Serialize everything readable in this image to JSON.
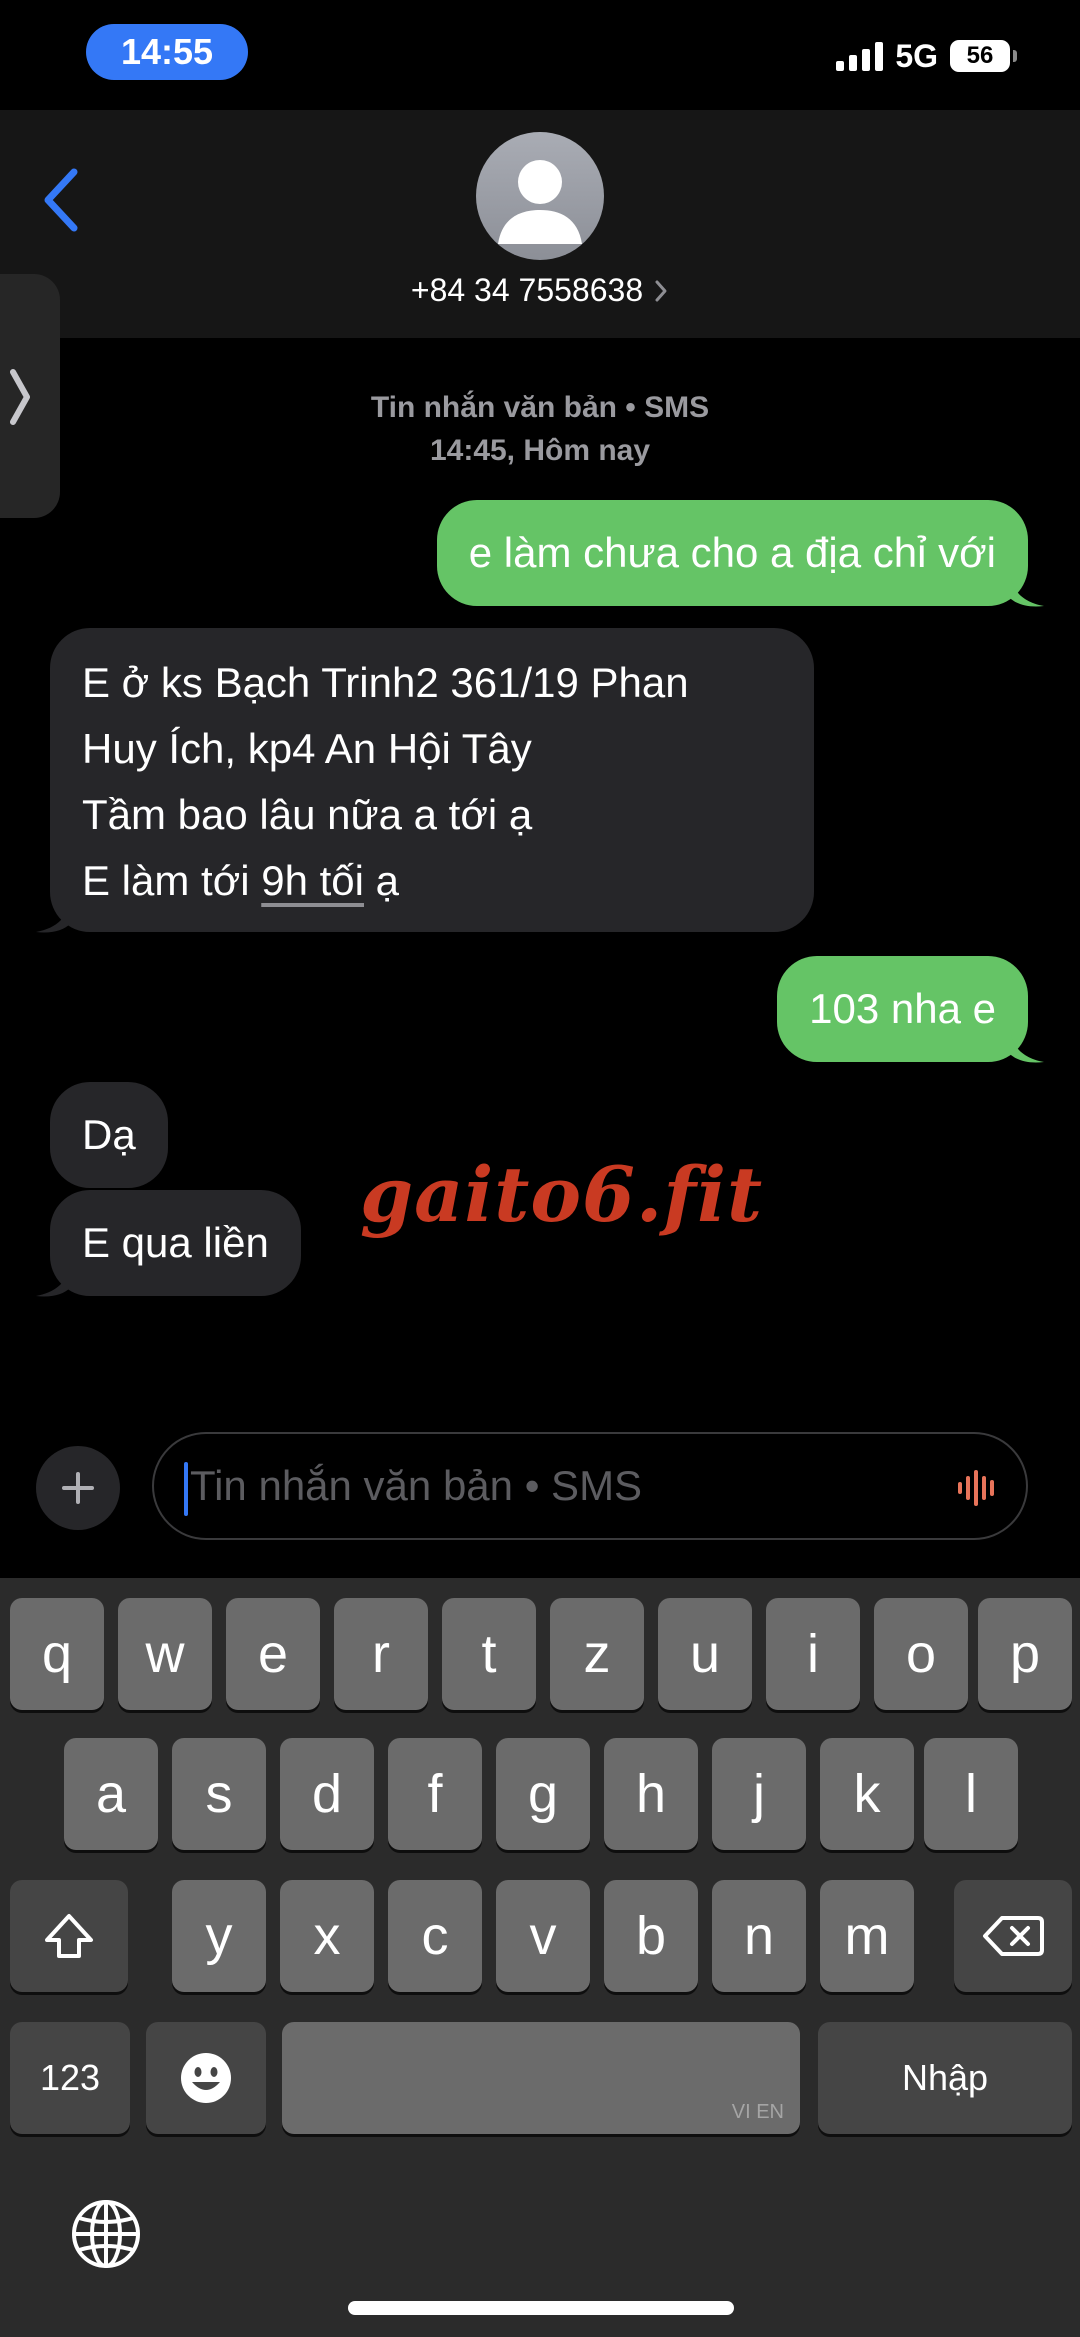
{
  "status_bar": {
    "time": "14:55",
    "network": "5G",
    "battery": "56"
  },
  "header": {
    "contact": "+84 34 7558638"
  },
  "thread_meta": {
    "type": "Tin nhắn văn bản • SMS",
    "time": "14:45, Hôm nay"
  },
  "messages": [
    {
      "direction": "outgoing",
      "text": "e làm chưa cho a địa chỉ với"
    },
    {
      "direction": "incoming",
      "lines": [
        "E ở ks Bạch Trinh2 361/19 Phan",
        "Huy Ích, kp4 An Hội Tây",
        "Tầm bao lâu nữa a tới ạ"
      ],
      "last_line_prefix": "E làm tới ",
      "last_line_link": "9h tối",
      "last_line_suffix": " ạ"
    },
    {
      "direction": "outgoing",
      "text": "103 nha e"
    },
    {
      "direction": "incoming",
      "text": "Dạ"
    },
    {
      "direction": "incoming",
      "text": "E qua liền"
    }
  ],
  "watermark": "gaito6.fit",
  "compose": {
    "placeholder": "Tin nhắn văn bản • SMS"
  },
  "keyboard": {
    "row1": [
      "q",
      "w",
      "e",
      "r",
      "t",
      "z",
      "u",
      "i",
      "o",
      "p"
    ],
    "row2": [
      "a",
      "s",
      "d",
      "f",
      "g",
      "h",
      "j",
      "k",
      "l"
    ],
    "row3": [
      "y",
      "x",
      "c",
      "v",
      "b",
      "n",
      "m"
    ],
    "numbers_key": "123",
    "space_tag": "VI EN",
    "return_key": "Nhập"
  },
  "icons": [
    "back-chevron-icon",
    "person-icon",
    "chevron-right-icon",
    "plus-icon",
    "waveform-icon",
    "shift-icon",
    "backspace-icon",
    "emoji-icon",
    "globe-icon"
  ],
  "colors": {
    "outgoing_bubble": "#65c466",
    "incoming_bubble": "#262629",
    "accent": "#3478f6",
    "watermark": "#c93a22"
  }
}
